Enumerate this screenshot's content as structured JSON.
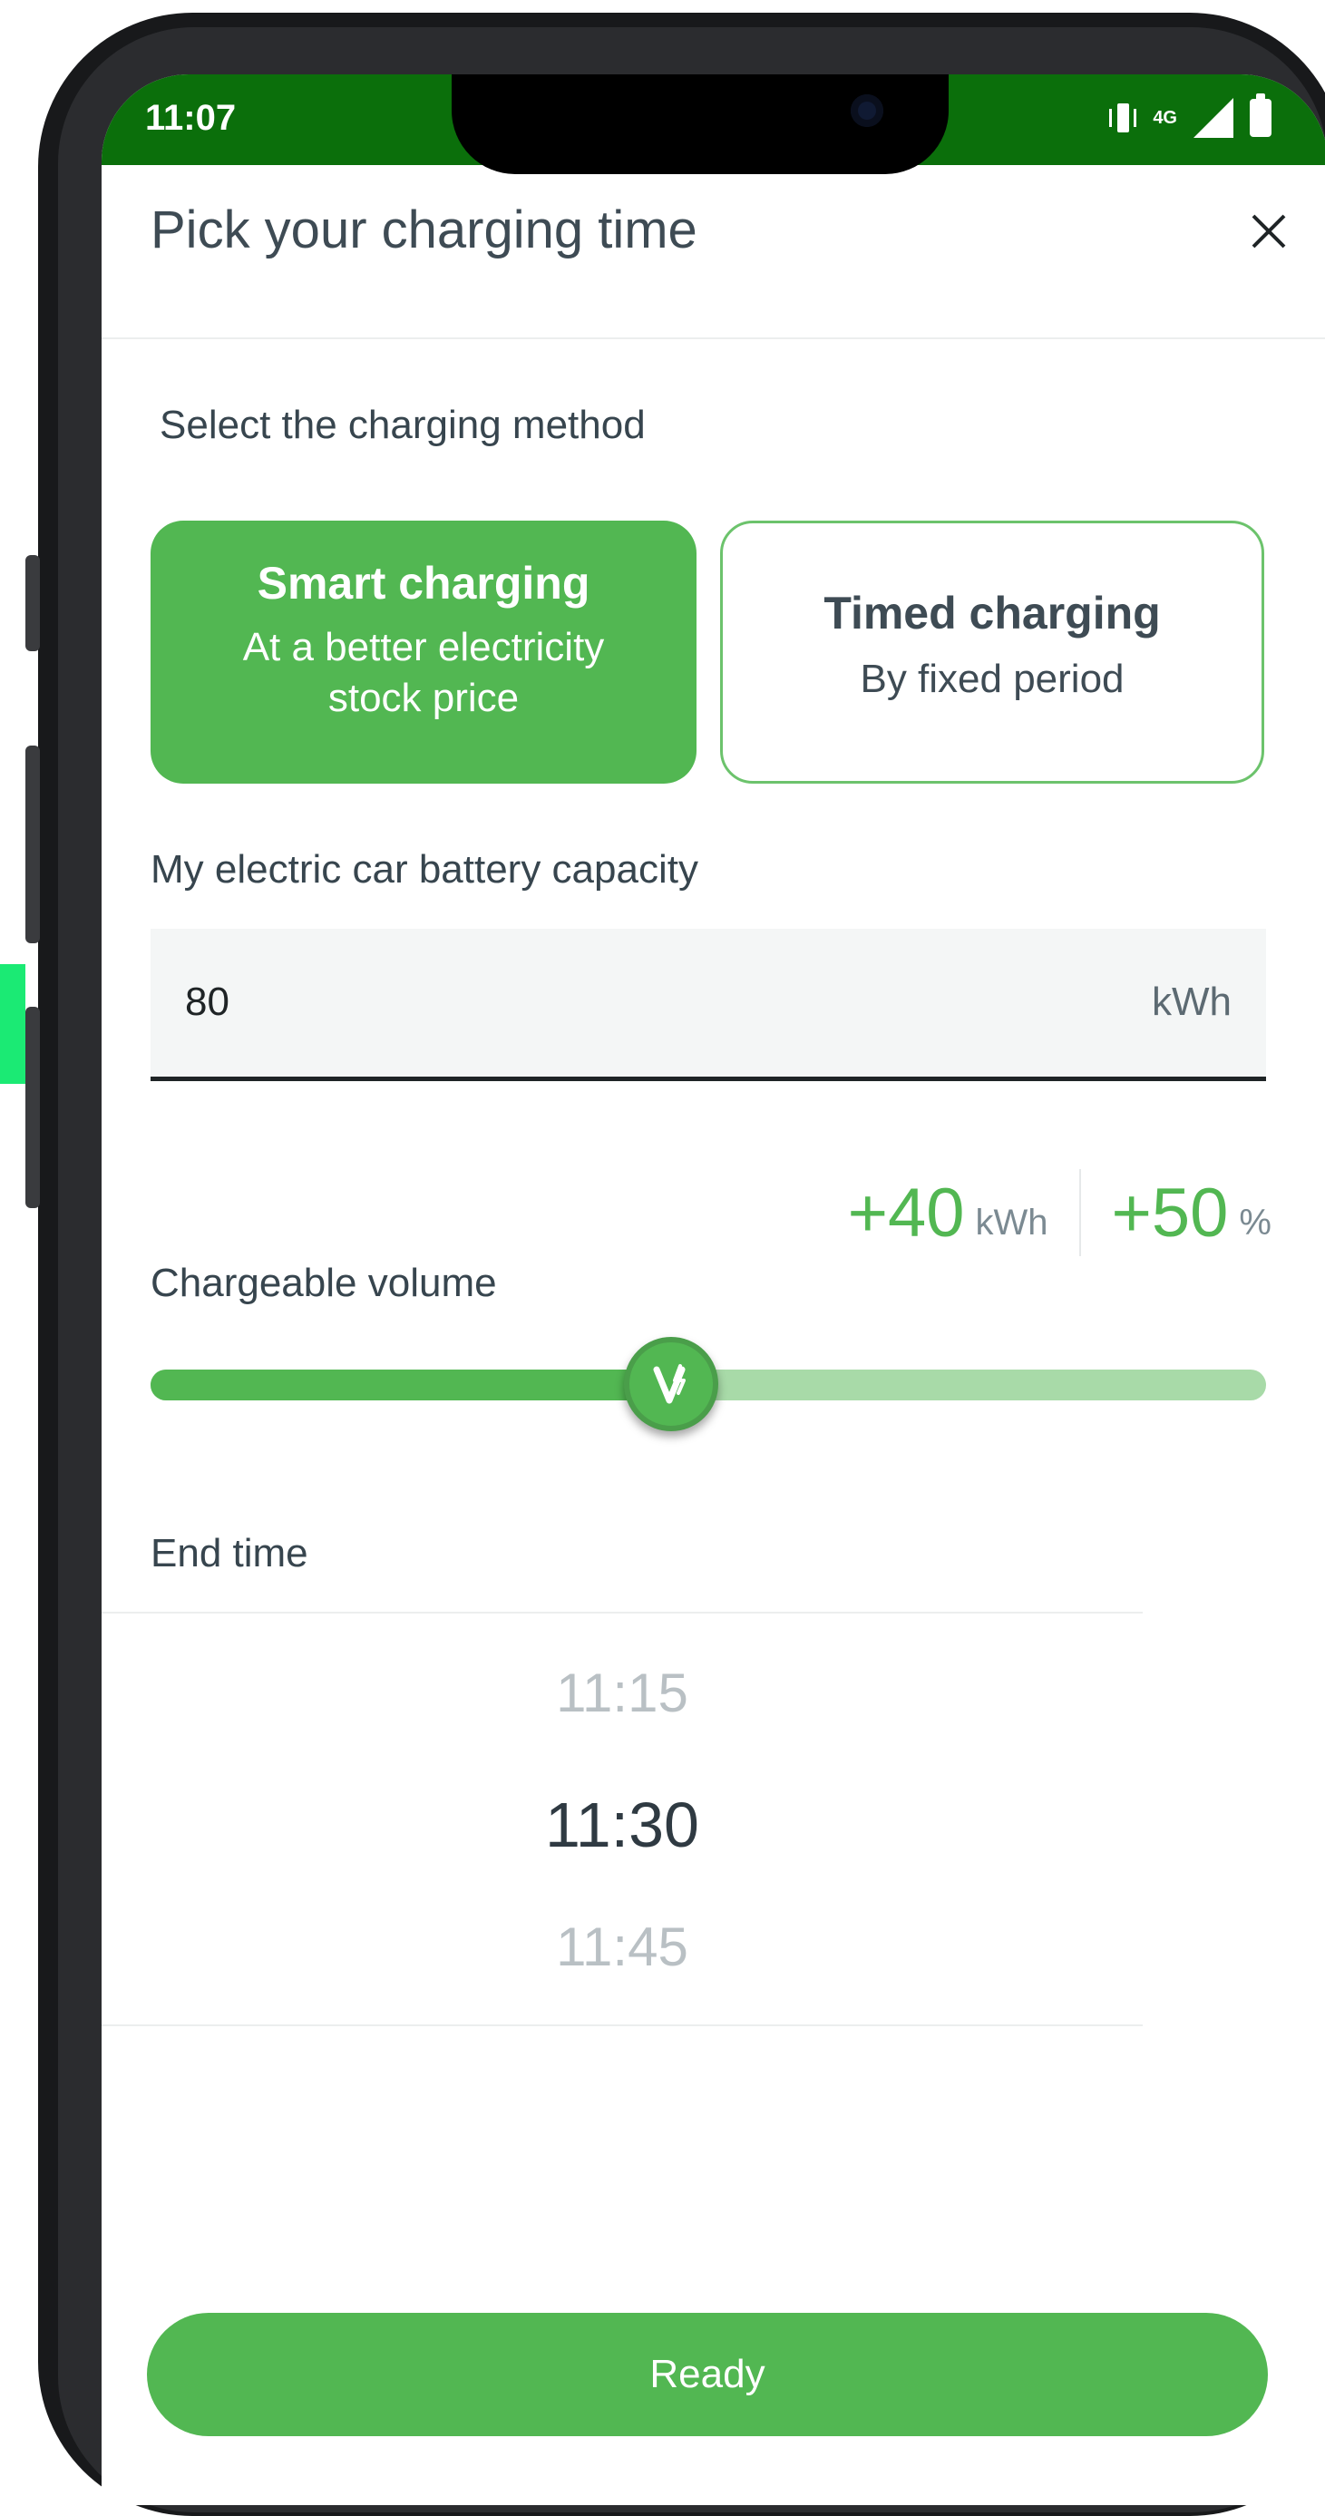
{
  "status_bar": {
    "time": "11:07",
    "network_label": "4G",
    "background": "#0b6f0b"
  },
  "header": {
    "title": "Pick your charging time",
    "close_icon": "close-icon"
  },
  "method_section": {
    "label": "Select the charging method",
    "options": [
      {
        "title": "Smart charging",
        "subtitle": "At a better electricity stock price",
        "selected": true
      },
      {
        "title": "Timed charging",
        "subtitle": "By fixed period",
        "selected": false
      }
    ]
  },
  "battery": {
    "label": "My electric car battery capacity",
    "value": "80",
    "unit": "kWh"
  },
  "charge_delta": {
    "kwh_value": "+40",
    "kwh_unit": "kWh",
    "percent_value": "+50",
    "percent_unit": "%"
  },
  "volume": {
    "label": "Chargeable volume",
    "level_percent": 50,
    "thumb_icon": "charging-bolt-icon"
  },
  "end_time": {
    "label": "End time",
    "options": [
      "11:15",
      "11:30",
      "11:45"
    ],
    "selected": "11:30"
  },
  "ready_button": {
    "label": "Ready"
  },
  "colors": {
    "accent": "#52b752",
    "accent_light": "#a8daa8",
    "text": "#3e4b54"
  }
}
